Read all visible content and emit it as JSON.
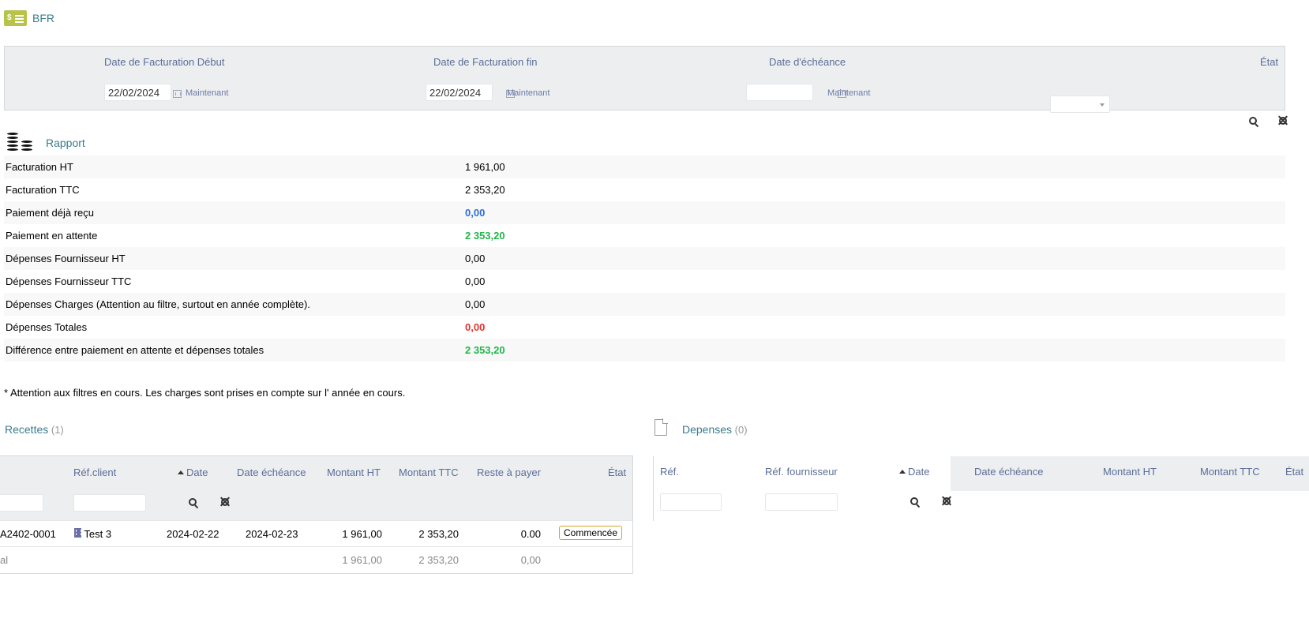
{
  "page": {
    "title": "BFR",
    "icon": "money-bill-icon"
  },
  "filters": {
    "date_debut": {
      "label": "Date de Facturation Début",
      "value": "22/02/2024",
      "now": "Maintenant"
    },
    "date_fin": {
      "label": "Date de Facturation fin",
      "value": "22/02/2024",
      "now": "Maintenant"
    },
    "date_echeance": {
      "label": "Date d'échéance",
      "value": "",
      "now": "Maintenant"
    },
    "etat": {
      "label": "État",
      "value": ""
    }
  },
  "rapport": {
    "title": "Rapport",
    "rows": [
      {
        "label": "Facturation HT",
        "value": "1 961,00",
        "color": ""
      },
      {
        "label": "Facturation TTC",
        "value": "2 353,20",
        "color": ""
      },
      {
        "label": "Paiement déjà reçu",
        "value": "0,00",
        "color": "blue"
      },
      {
        "label": "Paiement en attente",
        "value": "2 353,20",
        "color": "green"
      },
      {
        "label": "Dépenses Fournisseur HT",
        "value": "0,00",
        "color": ""
      },
      {
        "label": "Dépenses Fournisseur TTC",
        "value": "0,00",
        "color": ""
      },
      {
        "label": "Dépenses Charges (Attention au filtre, surtout en année complète).",
        "value": "0,00",
        "color": ""
      },
      {
        "label": "Dépenses Totales",
        "value": "0,00",
        "color": "red"
      },
      {
        "label": "Différence entre paiement en attente et dépenses totales",
        "value": "2 353,20",
        "color": "green"
      }
    ],
    "note": "* Attention aux filtres en cours. Les charges sont prises en compte sur l' année en cours."
  },
  "recettes": {
    "title": "Recettes",
    "count": "(1)",
    "columns": [
      "Réf.client",
      "Date",
      "Date échéance",
      "Montant HT",
      "Montant TTC",
      "Reste à payer",
      "État"
    ],
    "rows": [
      {
        "ref": "A2402-0001",
        "client": "Test 3",
        "date": "2024-02-22",
        "echeance": "2024-02-23",
        "ht": "1 961,00",
        "ttc": "2 353,20",
        "reste": "0.00",
        "etat": "Commencée"
      }
    ],
    "total": {
      "label": "al",
      "ht": "1 961,00",
      "ttc": "2 353,20",
      "reste": "0,00"
    }
  },
  "depenses": {
    "title": "Depenses",
    "count": "(0)",
    "columns": [
      "Réf.",
      "Réf. fournisseur",
      "Date",
      "Date échéance",
      "Montant HT",
      "Montant TTC",
      "État"
    ]
  },
  "colors": {
    "accent": "#3a7c8c",
    "label": "#5b6e98",
    "panel": "#eceef0",
    "green": "#23b54a",
    "red": "#e3342f",
    "blue": "#2d6fd6",
    "bfr_icon": "#b8c34a"
  }
}
